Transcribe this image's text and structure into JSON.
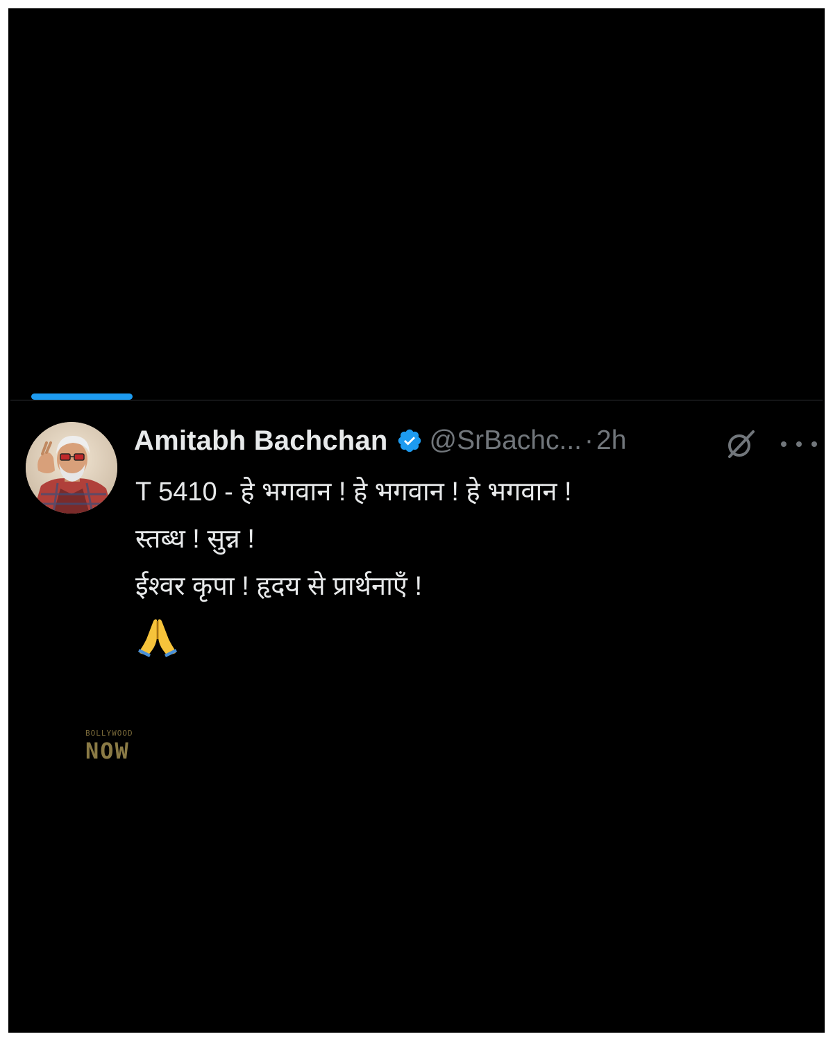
{
  "tweet": {
    "display_name": "Amitabh Bachchan",
    "verified_icon": "verified-badge-icon",
    "handle": "@SrBachc...",
    "separator": "·",
    "timestamp": "2h",
    "lines": [
      "T 5410 - हे भगवान ! हे भगवान ! हे भगवान !",
      "स्तब्ध ! सुन्न !",
      "ईश्वर कृपा ! हृदय से प्रार्थनाएँ !"
    ],
    "emoji": "folded-hands-emoji",
    "avatar_icon": "profile-avatar",
    "grok_icon": "grok-icon",
    "more_icon": "more-options-icon"
  },
  "watermark": {
    "top": "BOLLYWOOD",
    "main": "NOW"
  },
  "colors": {
    "background": "#000000",
    "accent": "#1d9bf0",
    "text_primary": "#e7e9ea",
    "text_secondary": "#71767b",
    "divider": "#2f3336"
  }
}
